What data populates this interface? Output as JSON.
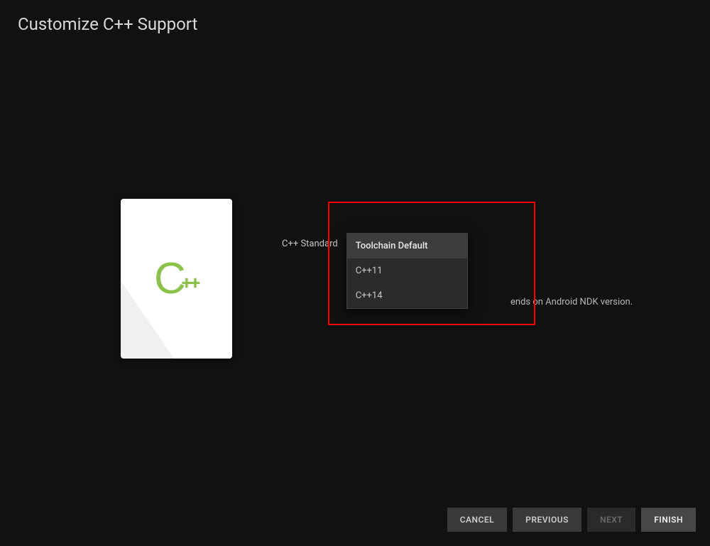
{
  "title": "Customize C++ Support",
  "card": {
    "logo_letter": "C",
    "logo_suffix": "++"
  },
  "field": {
    "label": "C++ Standard",
    "options": [
      "Toolchain Default",
      "C++11",
      "C++14"
    ],
    "selected": "Toolchain Default",
    "helper_tail": "ends on Android NDK version."
  },
  "buttons": {
    "cancel": "CANCEL",
    "previous": "PREVIOUS",
    "next": "NEXT",
    "finish": "FINISH"
  }
}
